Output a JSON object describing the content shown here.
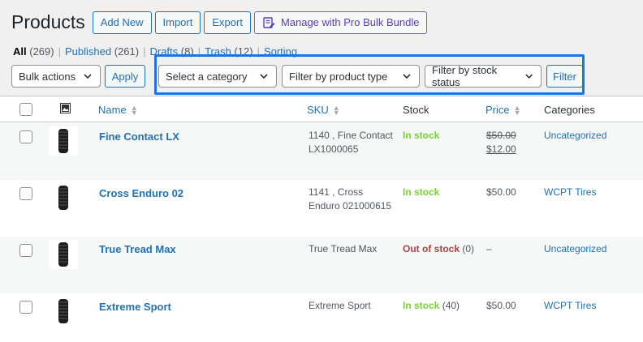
{
  "header": {
    "title": "Products",
    "buttons": {
      "add_new": "Add New",
      "import": "Import",
      "export": "Export",
      "pro": "Manage with Pro Bulk Bundle"
    }
  },
  "views": [
    {
      "label": "All",
      "count": "(269)"
    },
    {
      "label": "Published",
      "count": "(261)"
    },
    {
      "label": "Drafts",
      "count": "(8)"
    },
    {
      "label": "Trash",
      "count": "(12)"
    },
    {
      "label": "Sorting",
      "count": ""
    }
  ],
  "bulk": {
    "selected": "Bulk actions",
    "apply": "Apply"
  },
  "filters": {
    "category": "Select a category",
    "product_type": "Filter by product type",
    "stock_status": "Filter by stock status",
    "button": "Filter"
  },
  "columns": {
    "image_icon": "image-icon",
    "name": "Name",
    "sku": "SKU",
    "stock": "Stock",
    "price": "Price",
    "categories": "Categories"
  },
  "products": [
    {
      "name": "Fine Contact LX",
      "sku": "1140 , Fine Contact LX1000065",
      "stock_label": "In stock",
      "stock_qty": "",
      "stock_status": "instock",
      "price_regular": "$50.00",
      "price_sale": "$12.00",
      "category": "Uncategorized"
    },
    {
      "name": "Cross Enduro 02",
      "sku": "1141 , Cross Enduro 021000615",
      "stock_label": "In stock",
      "stock_qty": "",
      "stock_status": "instock",
      "price_regular": "$50.00",
      "price_sale": "",
      "category": "WCPT Tires"
    },
    {
      "name": "True Tread Max",
      "sku": "True Tread Max",
      "stock_label": "Out of stock",
      "stock_qty": "(0)",
      "stock_status": "outofstock",
      "price_regular": "–",
      "price_sale": "",
      "category": "Uncategorized"
    },
    {
      "name": "Extreme Sport",
      "sku": "Extreme Sport",
      "stock_label": "In stock",
      "stock_qty": "(40)",
      "stock_status": "instock",
      "price_regular": "$50.00",
      "price_sale": "",
      "category": "WCPT Tires"
    }
  ],
  "colors": {
    "accent": "#2271b1",
    "in_stock": "#7ad03a",
    "out_of_stock": "#aa4444",
    "highlight": "#1a73e8"
  }
}
